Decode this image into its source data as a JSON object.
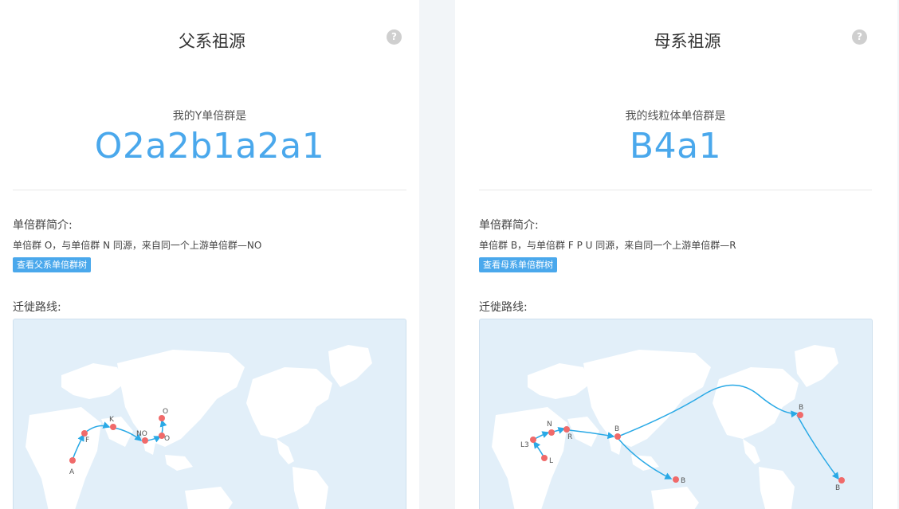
{
  "paternal": {
    "title": "父系祖源",
    "help_icon": "?",
    "subtitle": "我的Y单倍群是",
    "haplogroup": "O2a2b1a2a1",
    "intro_label": "单倍群简介:",
    "intro_text": "单倍群 O，与单倍群 N 同源，来自同一个上游单倍群—NO",
    "tree_button": "查看父系单倍群树",
    "route_label": "迁徙路线:",
    "map_points": [
      "A",
      "F",
      "K",
      "NO",
      "O",
      "O"
    ]
  },
  "maternal": {
    "title": "母系祖源",
    "help_icon": "?",
    "subtitle": "我的线粒体单倍群是",
    "haplogroup": "B4a1",
    "intro_label": "单倍群简介:",
    "intro_text": "单倍群 B，与单倍群 F P U 同源，来自同一个上游单倍群—R",
    "tree_button": "查看母系单倍群树",
    "route_label": "迁徙路线:",
    "map_points": [
      "L",
      "L3",
      "N",
      "R",
      "B",
      "B",
      "B",
      "B"
    ]
  },
  "colors": {
    "accent": "#4aa8ec",
    "route": "#29a9e6",
    "point": "#f06a6a",
    "map_water": "#e2eff9",
    "map_land": "#ffffff"
  }
}
